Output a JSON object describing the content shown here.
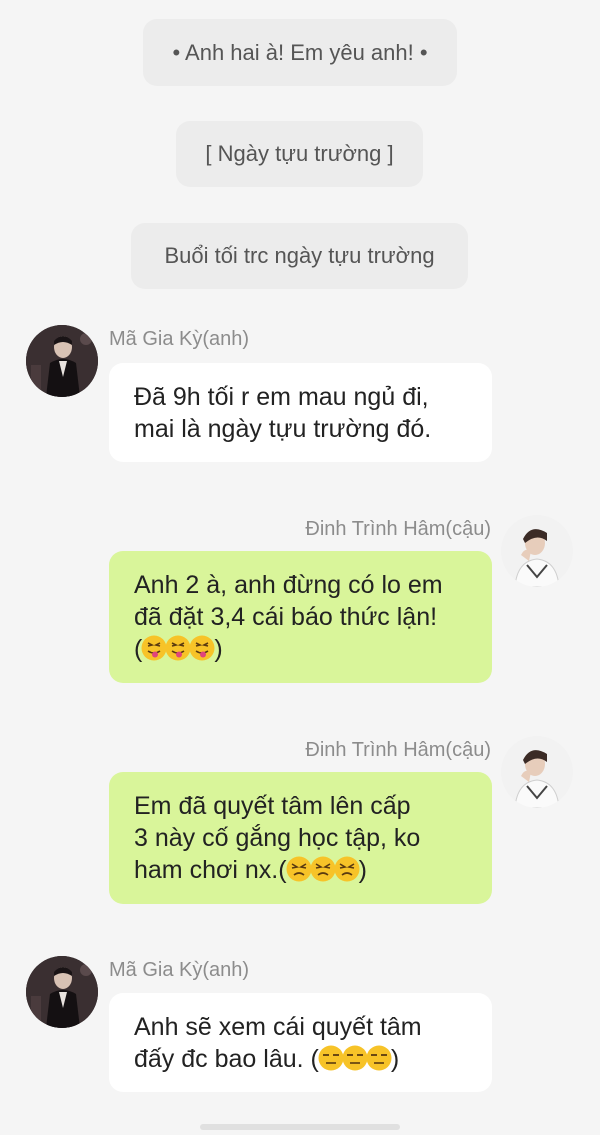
{
  "notes": [
    {
      "text": "• Anh hai à! Em yêu anh! •"
    },
    {
      "text": "[ Ngày tựu trường ]"
    },
    {
      "text": "Buổi tối trc ngày tựu trường"
    }
  ],
  "messages": [
    {
      "sender": "Mã Gia Kỳ(anh)",
      "avatar_icon": "avatar-dark-suit-icon",
      "lines": [
        "Đã 9h tối r em mau ngủ đi,",
        "mai là ngày tựu trường đó."
      ]
    },
    {
      "sender": "Đinh Trình Hâm(cậu)",
      "avatar_icon": "avatar-white-sweater-icon",
      "lines": [
        "Anh 2 à, anh đừng có lo em",
        "đã đặt 3,4 cái báo thức lận!",
        "(",
        ")"
      ]
    },
    {
      "sender": "Đinh Trình Hâm(cậu)",
      "avatar_icon": "avatar-white-sweater-icon",
      "lines": [
        "Em đã quyết tâm lên cấp",
        "3 này cố gắng học tập, ko",
        "ham chơi nx.(",
        ")"
      ]
    },
    {
      "sender": "Mã Gia Kỳ(anh)",
      "avatar_icon": "avatar-dark-suit-icon",
      "lines": [
        "Anh sẽ xem cái quyết tâm",
        "đấy đc bao lâu. (",
        ")"
      ]
    }
  ],
  "emoji_icons": {
    "tongue": "tongue-out-emoji-icon",
    "angry": "squint-angry-emoji-icon",
    "unamused": "unamused-emoji-icon"
  },
  "colors": {
    "background": "#f5f5f5",
    "note_bubble": "#ececec",
    "incoming_bubble": "#ffffff",
    "outgoing_bubble": "#d9f59a",
    "name_text": "#8c8c8c",
    "emoji_yellow": "#f7c328"
  }
}
